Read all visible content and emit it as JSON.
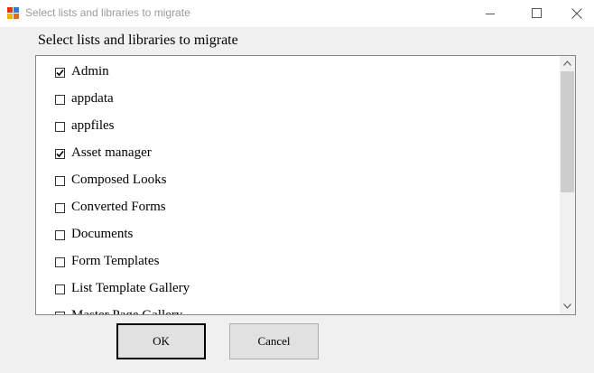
{
  "window": {
    "title": "Select lists and libraries to migrate"
  },
  "dialog": {
    "header": "Select lists and libraries to migrate"
  },
  "items": [
    {
      "label": "Admin",
      "checked": true
    },
    {
      "label": "appdata",
      "checked": false
    },
    {
      "label": "appfiles",
      "checked": false
    },
    {
      "label": "Asset manager",
      "checked": true
    },
    {
      "label": "Composed Looks",
      "checked": false
    },
    {
      "label": "Converted Forms",
      "checked": false
    },
    {
      "label": "Documents",
      "checked": false
    },
    {
      "label": "Form Templates",
      "checked": false
    },
    {
      "label": "List Template Gallery",
      "checked": false
    },
    {
      "label": "Master Page Gallery",
      "checked": false
    }
  ],
  "buttons": {
    "ok": "OK",
    "cancel": "Cancel"
  }
}
